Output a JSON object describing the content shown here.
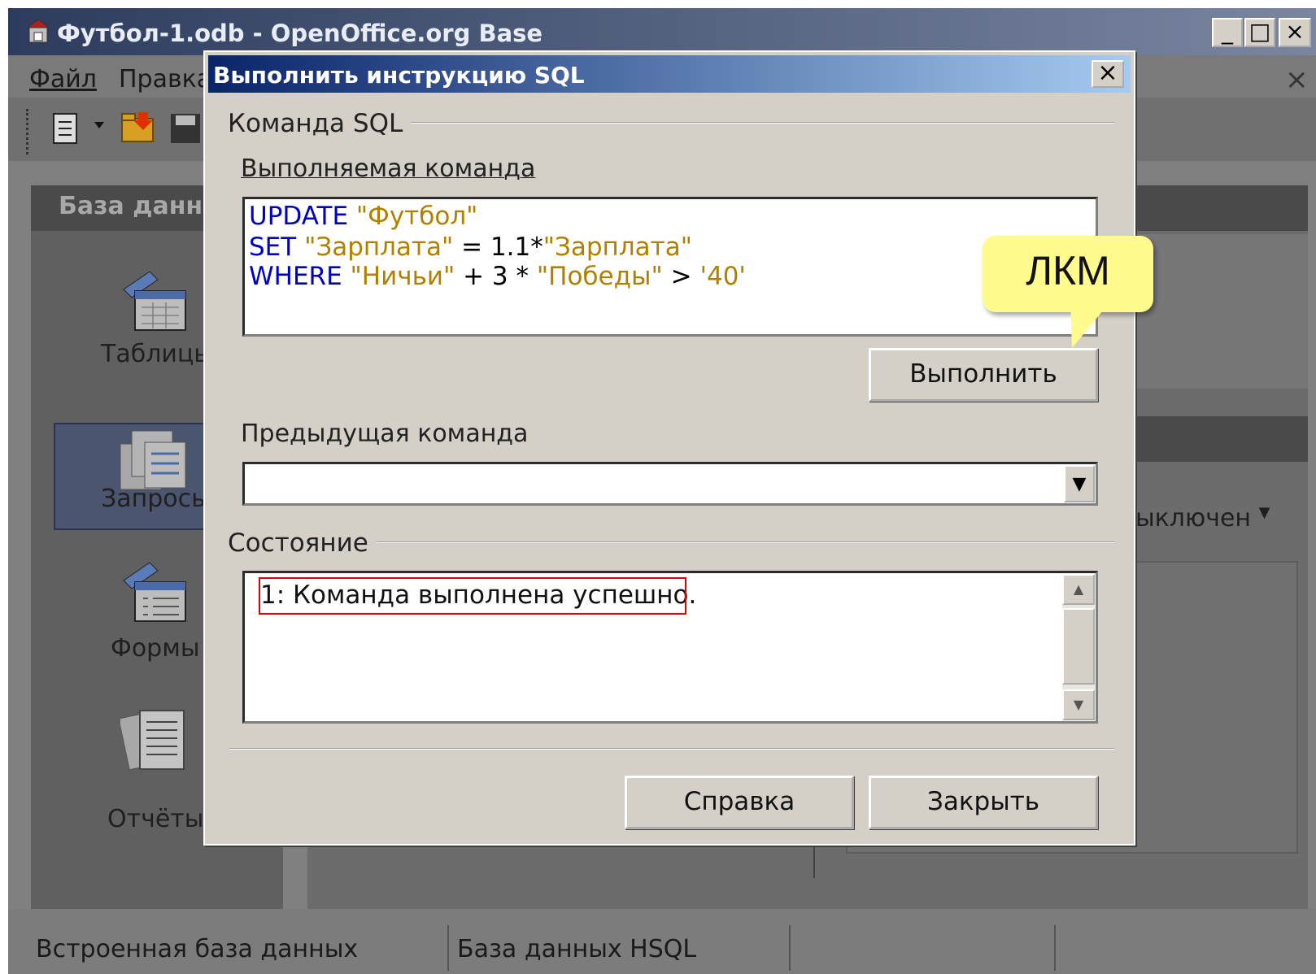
{
  "app": {
    "title": "Футбол-1.odb - OpenOffice.org Base",
    "menu": [
      "Файл",
      "Правка"
    ],
    "left_panel": {
      "header": "База данн",
      "items": [
        "Таблицы",
        "Запросы",
        "Формы",
        "Отчёты"
      ]
    },
    "right_panel": {
      "status_value": "ыключен"
    },
    "statusbar": [
      "Встроенная база данных",
      "База данных HSQL"
    ]
  },
  "dialog": {
    "title": "Выполнить инструкцию SQL",
    "group_sql": "Команда SQL",
    "exec_label": "Выполняемая команда",
    "sql_lines": [
      [
        "UPDATE ",
        "\"Футбол\""
      ],
      [
        "SET ",
        "\"Зарплата\"",
        " = 1.1*",
        "\"Зарплата\""
      ],
      [
        "WHERE ",
        "\"Ничьи\"",
        " + 3 * ",
        "\"Победы\"",
        " > ",
        "'40'"
      ]
    ],
    "execute_button": "Выполнить",
    "prev_label": "Предыдущая команда",
    "prev_value": "",
    "group_status": "Состояние",
    "status_text": "1: Команда выполнена успешно.",
    "help_button": "Справка",
    "close_button": "Закрыть"
  },
  "callout": {
    "text": "ЛКМ"
  }
}
